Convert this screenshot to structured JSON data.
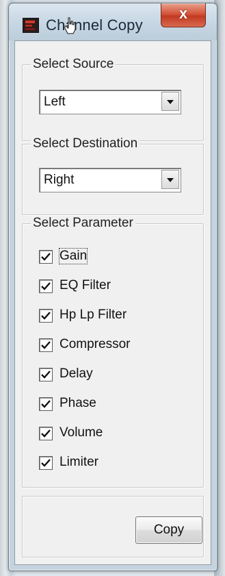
{
  "window": {
    "title": "Channel Copy",
    "close_label": "x"
  },
  "source": {
    "group_label": "Select Source",
    "selected": "Left"
  },
  "destination": {
    "group_label": "Select Destination",
    "selected": "Right"
  },
  "parameters": {
    "group_label": "Select Parameter",
    "items": [
      {
        "label": "Gain",
        "checked": true
      },
      {
        "label": "EQ Filter",
        "checked": true
      },
      {
        "label": "Hp Lp Filter",
        "checked": true
      },
      {
        "label": "Compressor",
        "checked": true
      },
      {
        "label": "Delay",
        "checked": true
      },
      {
        "label": "Phase",
        "checked": true
      },
      {
        "label": "Volume",
        "checked": true
      },
      {
        "label": "Limiter",
        "checked": true
      }
    ]
  },
  "actions": {
    "copy_label": "Copy"
  },
  "icons": {
    "app": "app-logo-icon",
    "close": "close-icon",
    "dropdown": "chevron-down-icon",
    "check": "checkmark-icon",
    "cursor": "mouse-pointer-icon"
  }
}
